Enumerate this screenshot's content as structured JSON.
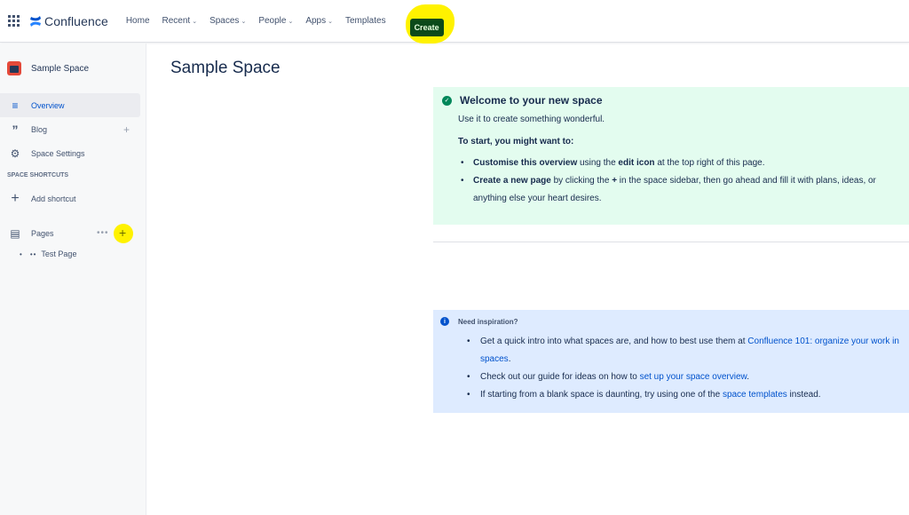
{
  "topnav": {
    "brand": "Confluence",
    "items": [
      {
        "label": "Home",
        "dropdown": false
      },
      {
        "label": "Recent",
        "dropdown": true
      },
      {
        "label": "Spaces",
        "dropdown": true
      },
      {
        "label": "People",
        "dropdown": true
      },
      {
        "label": "Apps",
        "dropdown": true
      },
      {
        "label": "Templates",
        "dropdown": false
      }
    ],
    "create_label": "Create",
    "highlight_color": "#fff200"
  },
  "sidebar": {
    "space_name": "Sample Space",
    "items": [
      {
        "label": "Overview",
        "icon": "overview-icon",
        "active": true
      },
      {
        "label": "Blog",
        "icon": "quote-icon"
      },
      {
        "label": "Space Settings",
        "icon": "gear-icon"
      }
    ],
    "shortcuts_header": "SPACE SHORTCUTS",
    "add_shortcut": "Add shortcut",
    "pages_label": "Pages",
    "tree": [
      {
        "label": "Test Page"
      }
    ]
  },
  "main": {
    "title": "Sample Space",
    "welcome": {
      "heading": "Welcome to your new space",
      "sub": "Use it to create something wonderful.",
      "start": "To start, you might want to:",
      "b1_bold": "Customise this overview",
      "b1_mid": " using the ",
      "b1_bold2": "edit icon",
      "b1_end": " at the top right of this page.",
      "b2_bold": "Create a new page",
      "b2_mid": " by clicking the ",
      "b2_bold2": "+",
      "b2_end": " in the space sidebar, then go ahead and fill it with plans, ideas, or anything else your heart desires."
    },
    "inspiration": {
      "heading": "Need inspiration?",
      "i1_text": "Get a quick intro into what spaces are, and how to best use them at ",
      "i1_link": "Confluence 101: organize your work in spaces",
      "i1_end": ".",
      "i2_text": "Check out our guide for ideas on how to ",
      "i2_link": "set up your space overview",
      "i2_end": ".",
      "i3_text": "If starting from a blank space is daunting, try using one of the ",
      "i3_link": "space templates",
      "i3_end": " instead."
    }
  }
}
